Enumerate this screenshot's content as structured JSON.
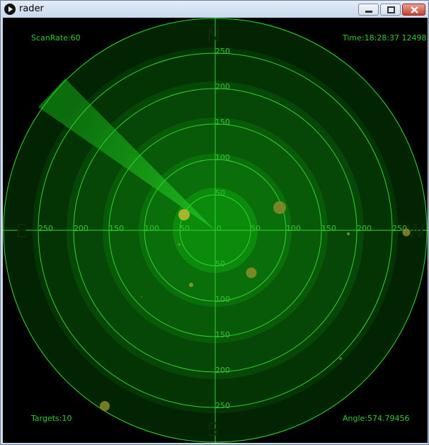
{
  "window": {
    "title": "rader",
    "minimize_icon": "minimize-icon",
    "maximize_icon": "maximize-icon",
    "close_icon": "close-icon",
    "app_icon": "play-icon"
  },
  "hud": {
    "scan_rate": "ScanRate:60",
    "time": "Time:18:28:37 12498",
    "targets": "Targets:10",
    "angle": "Angle:574.79456"
  },
  "compass": {
    "north": "N",
    "south": "S",
    "east": "E",
    "west": "W"
  },
  "range_labels": {
    "center": "0",
    "up": [
      "50",
      "100",
      "150",
      "200",
      "250"
    ],
    "down": [
      "50",
      "100",
      "150",
      "200",
      "250"
    ],
    "left": [
      "50",
      "100",
      "150",
      "200",
      "250"
    ],
    "right": [
      "50",
      "100",
      "150",
      "200",
      "250"
    ]
  },
  "colors": {
    "ring": "#2fd42f",
    "sweep": "#19a819",
    "target": "#9a9a22",
    "background": "#000000"
  }
}
